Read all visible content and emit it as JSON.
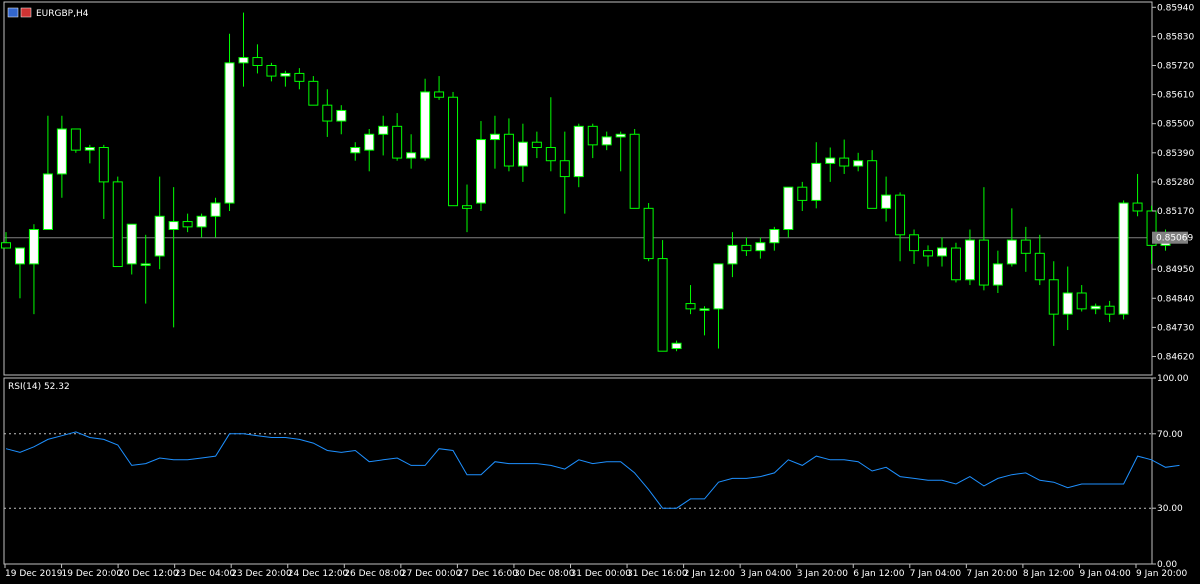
{
  "window": {
    "symbol_label": "EURGBP,H4"
  },
  "rsi_panel": {
    "label": "RSI(14) 52.32"
  },
  "current_price_label": "0.85069",
  "colors": {
    "background": "#000000",
    "grid_border": "#c0c0c0",
    "bull_body": "#ffffff",
    "bear_body": "#000000",
    "wick": "#00ff00",
    "rsi_line": "#1e90ff",
    "price_line": "#808080",
    "level_line": "#c0c0c0",
    "icon_blue": "#3366cc",
    "icon_red": "#cc3333"
  },
  "chart_data": [
    {
      "type": "candlestick",
      "title": "EURGBP,H4",
      "ylim": [
        0.8455,
        0.8596
      ],
      "y_ticks": [
        "0.85940",
        "0.85830",
        "0.85720",
        "0.85610",
        "0.85500",
        "0.85390",
        "0.85280",
        "0.85170",
        "0.84950",
        "0.84840",
        "0.84730",
        "0.84620"
      ],
      "x_tick_labels": [
        "19 Dec 2019",
        "19 Dec 20:00",
        "20 Dec 12:00",
        "23 Dec 04:00",
        "23 Dec 20:00",
        "24 Dec 12:00",
        "26 Dec 08:00",
        "27 Dec 00:00",
        "27 Dec 16:00",
        "30 Dec 08:00",
        "31 Dec 00:00",
        "31 Dec 16:00",
        "2 Jan 12:00",
        "3 Jan 04:00",
        "3 Jan 20:00",
        "6 Jan 12:00",
        "7 Jan 04:00",
        "7 Jan 20:00",
        "8 Jan 12:00",
        "9 Jan 04:00",
        "9 Jan 20:00"
      ],
      "last_price": 0.85069,
      "candles": [
        [
          0.8505,
          0.8509,
          0.8503,
          0.8503
        ],
        [
          0.8497,
          0.8502,
          0.8484,
          0.8503
        ],
        [
          0.8497,
          0.8512,
          0.8478,
          0.851
        ],
        [
          0.851,
          0.8553,
          0.851,
          0.8531
        ],
        [
          0.8531,
          0.8553,
          0.8522,
          0.8548
        ],
        [
          0.8548,
          0.8548,
          0.8539,
          0.854
        ],
        [
          0.854,
          0.8542,
          0.8535,
          0.8541
        ],
        [
          0.8541,
          0.8542,
          0.8514,
          0.8528
        ],
        [
          0.8528,
          0.853,
          0.8496,
          0.8496
        ],
        [
          0.8497,
          0.8512,
          0.8493,
          0.8512
        ],
        [
          0.8497,
          0.8508,
          0.8482,
          0.8497
        ],
        [
          0.85,
          0.853,
          0.8495,
          0.8515
        ],
        [
          0.851,
          0.8526,
          0.8473,
          0.8513
        ],
        [
          0.8513,
          0.8516,
          0.8509,
          0.8511
        ],
        [
          0.8511,
          0.8516,
          0.8507,
          0.8515
        ],
        [
          0.8515,
          0.8522,
          0.8507,
          0.852
        ],
        [
          0.852,
          0.8584,
          0.8517,
          0.8573
        ],
        [
          0.8573,
          0.8592,
          0.8564,
          0.8575
        ],
        [
          0.8575,
          0.858,
          0.8569,
          0.8572
        ],
        [
          0.8572,
          0.8573,
          0.8566,
          0.8568
        ],
        [
          0.8568,
          0.857,
          0.8564,
          0.8569
        ],
        [
          0.8569,
          0.8571,
          0.8563,
          0.8566
        ],
        [
          0.8566,
          0.8568,
          0.8557,
          0.8557
        ],
        [
          0.8557,
          0.8563,
          0.8545,
          0.8551
        ],
        [
          0.8551,
          0.8557,
          0.8546,
          0.8555
        ],
        [
          0.8539,
          0.8543,
          0.8536,
          0.8541
        ],
        [
          0.854,
          0.8548,
          0.8532,
          0.8546
        ],
        [
          0.8546,
          0.8553,
          0.8538,
          0.8549
        ],
        [
          0.8549,
          0.8554,
          0.8536,
          0.8537
        ],
        [
          0.8537,
          0.8546,
          0.8533,
          0.8539
        ],
        [
          0.8537,
          0.8567,
          0.8536,
          0.8562
        ],
        [
          0.8562,
          0.8568,
          0.8559,
          0.856
        ],
        [
          0.856,
          0.8562,
          0.8519,
          0.8519
        ],
        [
          0.8519,
          0.8527,
          0.8509,
          0.8518
        ],
        [
          0.852,
          0.8551,
          0.8517,
          0.8544
        ],
        [
          0.8544,
          0.8553,
          0.8533,
          0.8546
        ],
        [
          0.8546,
          0.8552,
          0.8532,
          0.8534
        ],
        [
          0.8534,
          0.855,
          0.8528,
          0.8543
        ],
        [
          0.8543,
          0.8547,
          0.8537,
          0.8541
        ],
        [
          0.8541,
          0.856,
          0.8532,
          0.8536
        ],
        [
          0.8536,
          0.8547,
          0.8516,
          0.853
        ],
        [
          0.853,
          0.855,
          0.8526,
          0.8549
        ],
        [
          0.8549,
          0.855,
          0.8537,
          0.8542
        ],
        [
          0.8542,
          0.8547,
          0.854,
          0.8545
        ],
        [
          0.8545,
          0.8547,
          0.8532,
          0.8546
        ],
        [
          0.8546,
          0.8548,
          0.8518,
          0.8518
        ],
        [
          0.8518,
          0.852,
          0.8498,
          0.8499
        ],
        [
          0.8499,
          0.8506,
          0.8464,
          0.8464
        ],
        [
          0.8465,
          0.8468,
          0.8464,
          0.8467
        ],
        [
          0.8482,
          0.8489,
          0.8478,
          0.848
        ],
        [
          0.848,
          0.8481,
          0.847,
          0.848
        ],
        [
          0.848,
          0.8495,
          0.8465,
          0.8497
        ],
        [
          0.8497,
          0.8509,
          0.8492,
          0.8504
        ],
        [
          0.8504,
          0.8507,
          0.85,
          0.8502
        ],
        [
          0.8502,
          0.8507,
          0.8499,
          0.8505
        ],
        [
          0.8505,
          0.8511,
          0.8502,
          0.851
        ],
        [
          0.851,
          0.8525,
          0.8507,
          0.8526
        ],
        [
          0.8526,
          0.8528,
          0.8517,
          0.8521
        ],
        [
          0.8521,
          0.8543,
          0.8518,
          0.8535
        ],
        [
          0.8535,
          0.8541,
          0.8528,
          0.8537
        ],
        [
          0.8537,
          0.8544,
          0.8531,
          0.8534
        ],
        [
          0.8534,
          0.8539,
          0.8532,
          0.8536
        ],
        [
          0.8536,
          0.854,
          0.8518,
          0.8518
        ],
        [
          0.8518,
          0.853,
          0.8513,
          0.8523
        ],
        [
          0.8523,
          0.8524,
          0.8498,
          0.8508
        ],
        [
          0.8508,
          0.851,
          0.8497,
          0.8502
        ],
        [
          0.8502,
          0.8504,
          0.8496,
          0.85
        ],
        [
          0.85,
          0.8507,
          0.8496,
          0.8503
        ],
        [
          0.8503,
          0.8505,
          0.849,
          0.8491
        ],
        [
          0.8491,
          0.851,
          0.8489,
          0.8506
        ],
        [
          0.8506,
          0.8526,
          0.8487,
          0.8489
        ],
        [
          0.8489,
          0.8502,
          0.8486,
          0.8497
        ],
        [
          0.8497,
          0.8518,
          0.8496,
          0.8506
        ],
        [
          0.8506,
          0.8511,
          0.8494,
          0.8501
        ],
        [
          0.8501,
          0.8508,
          0.8489,
          0.8491
        ],
        [
          0.8491,
          0.8498,
          0.8466,
          0.8478
        ],
        [
          0.8478,
          0.8496,
          0.8472,
          0.8486
        ],
        [
          0.8486,
          0.8489,
          0.8479,
          0.848
        ],
        [
          0.848,
          0.8482,
          0.8478,
          0.8481
        ],
        [
          0.8481,
          0.8483,
          0.8475,
          0.8478
        ],
        [
          0.8478,
          0.8521,
          0.8476,
          0.852
        ],
        [
          0.852,
          0.8531,
          0.8515,
          0.8517
        ],
        [
          0.8517,
          0.8519,
          0.8497,
          0.8504
        ],
        [
          0.8504,
          0.851,
          0.8502,
          0.8508
        ]
      ]
    },
    {
      "type": "line",
      "title": "RSI(14) 52.32",
      "ylim": [
        0,
        100
      ],
      "y_ticks": [
        "100.00",
        "70.00",
        "30.00",
        "0.00"
      ],
      "levels": [
        70,
        30
      ],
      "series": [
        {
          "values": [
            62,
            60,
            63,
            67,
            69,
            71,
            68,
            67,
            64,
            53,
            54,
            57,
            56,
            56,
            57,
            58,
            70,
            70,
            69,
            68,
            68,
            67,
            65,
            61,
            60,
            61,
            55,
            56,
            57,
            53,
            53,
            62,
            61,
            48,
            48,
            55,
            54,
            54,
            54,
            53,
            51,
            56,
            54,
            55,
            55,
            49,
            40,
            30,
            30,
            35,
            35,
            44,
            46,
            46,
            47,
            49,
            56,
            53,
            58,
            56,
            56,
            55,
            50,
            52,
            47,
            46,
            45,
            45,
            43,
            47,
            42,
            46,
            48,
            49,
            45,
            44,
            41,
            43,
            43,
            43,
            43,
            58,
            56,
            52,
            53
          ]
        }
      ]
    }
  ]
}
